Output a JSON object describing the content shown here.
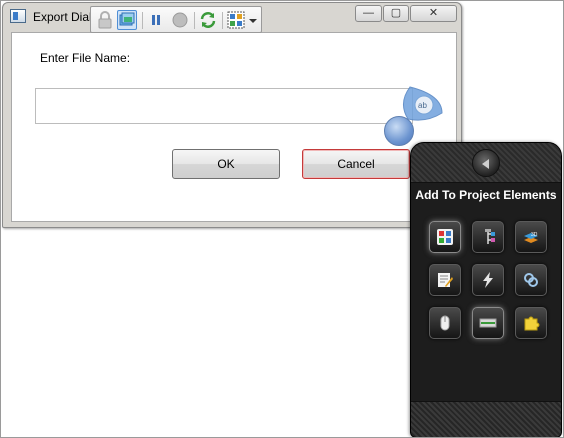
{
  "dialog": {
    "title": "Export Dialog",
    "label": "Enter File Name:",
    "filename_value": "",
    "ok_label": "OK",
    "cancel_label": "Cancel"
  },
  "caption_buttons": {
    "minimize": "—",
    "maximize": "▢",
    "close": "✕"
  },
  "toolbar": {
    "icons": [
      "lock-icon",
      "window-select-icon",
      "pause-icon",
      "record-icon",
      "refresh-icon",
      "grid-options-icon",
      "dropdown-arrow-icon"
    ]
  },
  "panel": {
    "title": "Add To Project Elements",
    "tiles": [
      "elements-icon",
      "tree-icon",
      "3d-layers-icon",
      "edit-icon",
      "lightning-icon",
      "link-icon",
      "mouse-icon",
      "bar-icon",
      "puzzle-icon"
    ],
    "selected_tile": "bar-icon"
  },
  "colors": {
    "accent_blue": "#3a7bc8",
    "cancel_border": "#c43a3a",
    "panel_bg": "#1d1d1d"
  }
}
